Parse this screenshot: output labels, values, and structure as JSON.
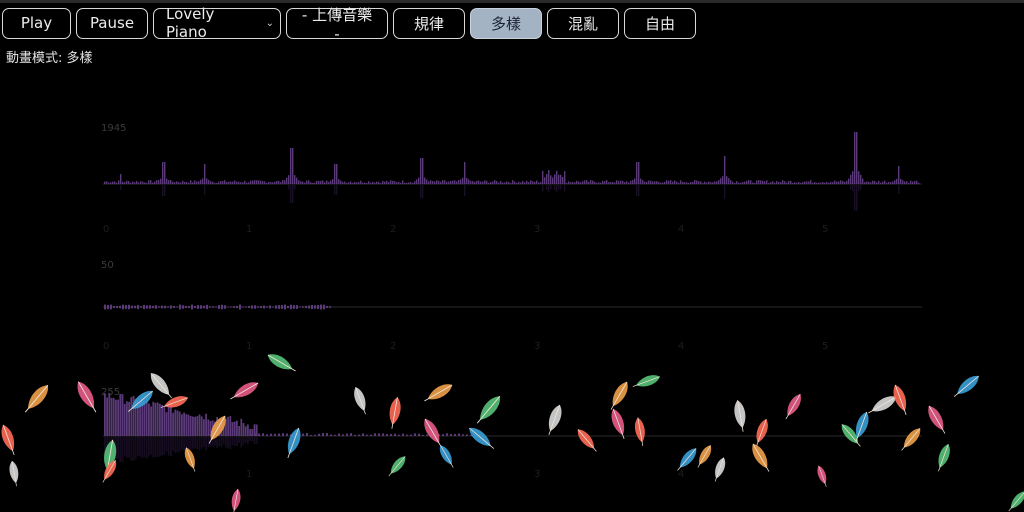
{
  "toolbar": {
    "play_label": "Play",
    "pause_label": "Pause",
    "sound_select_value": "Lovely Piano",
    "upload_label": "- 上傳音樂 -",
    "modes": [
      "規律",
      "多樣",
      "混亂",
      "自由"
    ],
    "active_mode": "多樣",
    "active_color": "#a3b3c4"
  },
  "status": {
    "mode_prefix": "動畫模式:",
    "mode_value": "多樣",
    "mode_text": "動畫模式: 多樣"
  },
  "icons": {
    "dropdown": "chevron-down-icon",
    "particles": "feather-icon"
  },
  "charts": {
    "series_color": "#5a3a78",
    "waveform": {
      "ymax": "1945",
      "x_ticks": [
        "0",
        "1",
        "2",
        "3",
        "4",
        "5"
      ]
    },
    "mid": {
      "ymax": "50",
      "x_ticks": [
        "0",
        "1",
        "2",
        "3",
        "4",
        "5"
      ]
    },
    "spectrum": {
      "ymax": "255",
      "x_ticks": [
        "1",
        "3",
        "4"
      ]
    }
  },
  "feather_colors": [
    "#ff6b57",
    "#f0a14a",
    "#e85c8a",
    "#58c37a",
    "#3aa0d8",
    "#d9d9d9"
  ]
}
